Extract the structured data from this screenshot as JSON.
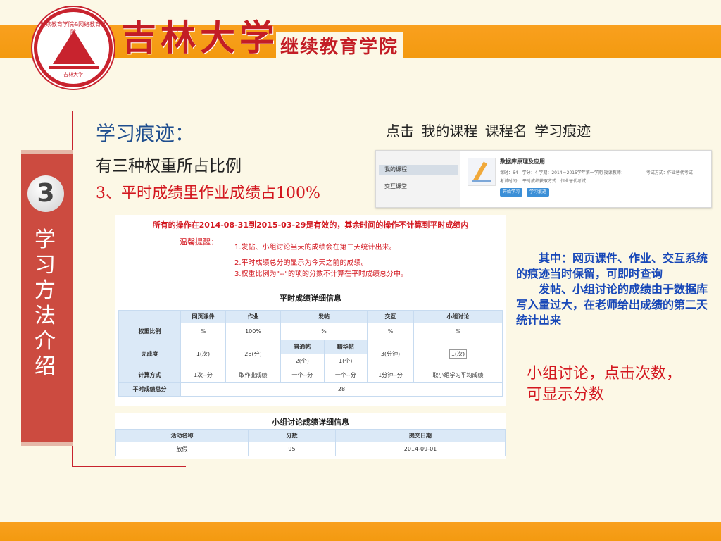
{
  "header": {
    "logo_ring_text": "继续教育学院&网络教育学院",
    "logo_small_text": "吉林大学",
    "university": "吉林大学",
    "college": "继续教育学院"
  },
  "side": {
    "number": "3",
    "title": "学习方法介绍"
  },
  "content": {
    "title": "学习痕迹：",
    "subtitle": "有三种权重所占比例",
    "point": "3、平时成绩里作业成绩占100%",
    "click_path": "点击 我的课程 课程名 学习痕迹"
  },
  "course_screen": {
    "nav": [
      "我的课程",
      "交互课堂"
    ],
    "course_name": "数据库原理及应用",
    "meta_line1": "课时：64　学分：4 学期：2014－2015学年第一学期 授课教师：",
    "meta_exam": "考试方式：作业替代考试",
    "meta_line2": "考试时间:　平时成绩获取方式：作业替代考试",
    "buttons": [
      "开始学习",
      "学习痕迹"
    ]
  },
  "grade_screen": {
    "notice": "所有的操作在2014-08-31到2015-03-29是有效的，其余时间的操作不计算到平时成绩内",
    "tip_label": "温馨提醒：",
    "tips": [
      "1.发帖、小组讨论当天的成绩会在第二天统计出来。",
      "2.平时成绩总分的显示为今天之前的成绩。",
      "3.权重比例为\"--\"的项的分数不计算在平时成绩总分中。"
    ],
    "title": "平时成绩详细信息",
    "columns": [
      "网页课件",
      "作业",
      "发帖",
      "交互",
      "小组讨论"
    ],
    "row_weight_label": "权重比例",
    "weights": [
      "%",
      "100%",
      "%",
      "%",
      "%"
    ],
    "row_done_label": "完成度",
    "done": [
      "1(次)",
      "28(分)",
      "3(分钟)",
      "1(次)"
    ],
    "post_sub": [
      "普通帖",
      "精华帖"
    ],
    "post_done": [
      "2(个)",
      "1(个)"
    ],
    "row_method_label": "计算方式",
    "methods": [
      "1次--分",
      "取作业成绩",
      "一个--分",
      "一个--分",
      "1分钟--分",
      "取小组学习平均成绩"
    ],
    "row_total_label": "平时成绩总分",
    "total": "28"
  },
  "group_screen": {
    "title": "小组讨论成绩详细信息",
    "columns": [
      "活动名称",
      "分数",
      "提交日期"
    ],
    "rows": [
      [
        "放假",
        "95",
        "2014-09-01"
      ]
    ]
  },
  "notes": {
    "blue_p1": "其中：网页课件、作业、交互系统的痕迹当时保留，可即时查询",
    "blue_p2": "发帖、小组讨论的成绩由于数据库写入量过大，在老师给出成绩的第二天统计出来",
    "red": "小组讨论，点击次数，可显示分数"
  },
  "colors": {
    "band": "#f9a01e",
    "brand_red": "#c31d25",
    "side_panel": "#cc4b40",
    "title_blue": "#1f4e8f",
    "note_blue": "#1848b8"
  }
}
